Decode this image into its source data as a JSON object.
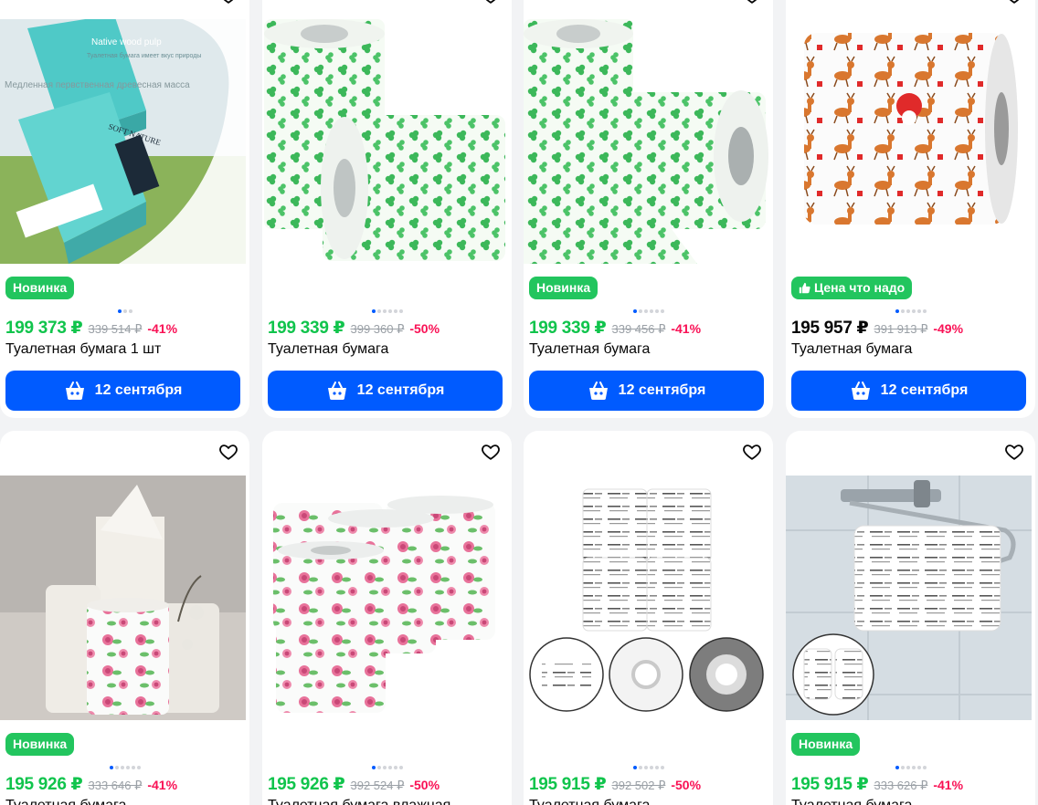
{
  "colors": {
    "accent": "#005bff",
    "price_green": "#10c44c",
    "discount_pink": "#f91155",
    "badge_green": "#22c55e"
  },
  "icons": {
    "favorite": "heart-icon",
    "cart": "basket-icon",
    "badge_thumb": "thumbs-up-icon"
  },
  "products": [
    {
      "badge": "Новинка",
      "price": "199 373 ₽",
      "old_price": "339 514 ₽",
      "discount": "-41%",
      "title": "Туалетная бумага 1 шт",
      "delivery": "12 сентября",
      "dots": 3,
      "active_dot": 0,
      "img_text_1": "Native wood pulp",
      "img_text_2": "Туалетная бумага имеет вкус природы",
      "img_text_3": "Медленная первственная древесная масса",
      "img_text_4": "SOFT NATURE"
    },
    {
      "badge": "",
      "price": "199 339 ₽",
      "old_price": "399 360 ₽",
      "discount": "-50%",
      "title": "Туалетная бумага",
      "delivery": "12 сентября",
      "dots": 6,
      "active_dot": 0
    },
    {
      "badge": "Новинка",
      "price": "199 339 ₽",
      "old_price": "339 456 ₽",
      "discount": "-41%",
      "title": "Туалетная бумага",
      "delivery": "12 сентября",
      "dots": 6,
      "active_dot": 0
    },
    {
      "badge": "Цена что надо",
      "price": "195 957 ₽",
      "old_price": "391 913 ₽",
      "discount": "-49%",
      "title": "Туалетная бумага",
      "delivery": "12 сентября",
      "dots": 6,
      "active_dot": 0
    },
    {
      "badge": "Новинка",
      "price": "195 926 ₽",
      "old_price": "333 646 ₽",
      "discount": "-41%",
      "title": "Туалетная бумага",
      "dots": 6,
      "active_dot": 0
    },
    {
      "badge": "",
      "price": "195 926 ₽",
      "old_price": "392 524 ₽",
      "discount": "-50%",
      "title": "Туалетная бумага влажная",
      "dots": 6,
      "active_dot": 0
    },
    {
      "badge": "",
      "price": "195 915 ₽",
      "old_price": "392 502 ₽",
      "discount": "-50%",
      "title": "Туалетная бумага",
      "dots": 6,
      "active_dot": 0
    },
    {
      "badge": "Новинка",
      "price": "195 915 ₽",
      "old_price": "333 626 ₽",
      "discount": "-41%",
      "title": "Туалетная бумага",
      "dots": 6,
      "active_dot": 0
    }
  ]
}
